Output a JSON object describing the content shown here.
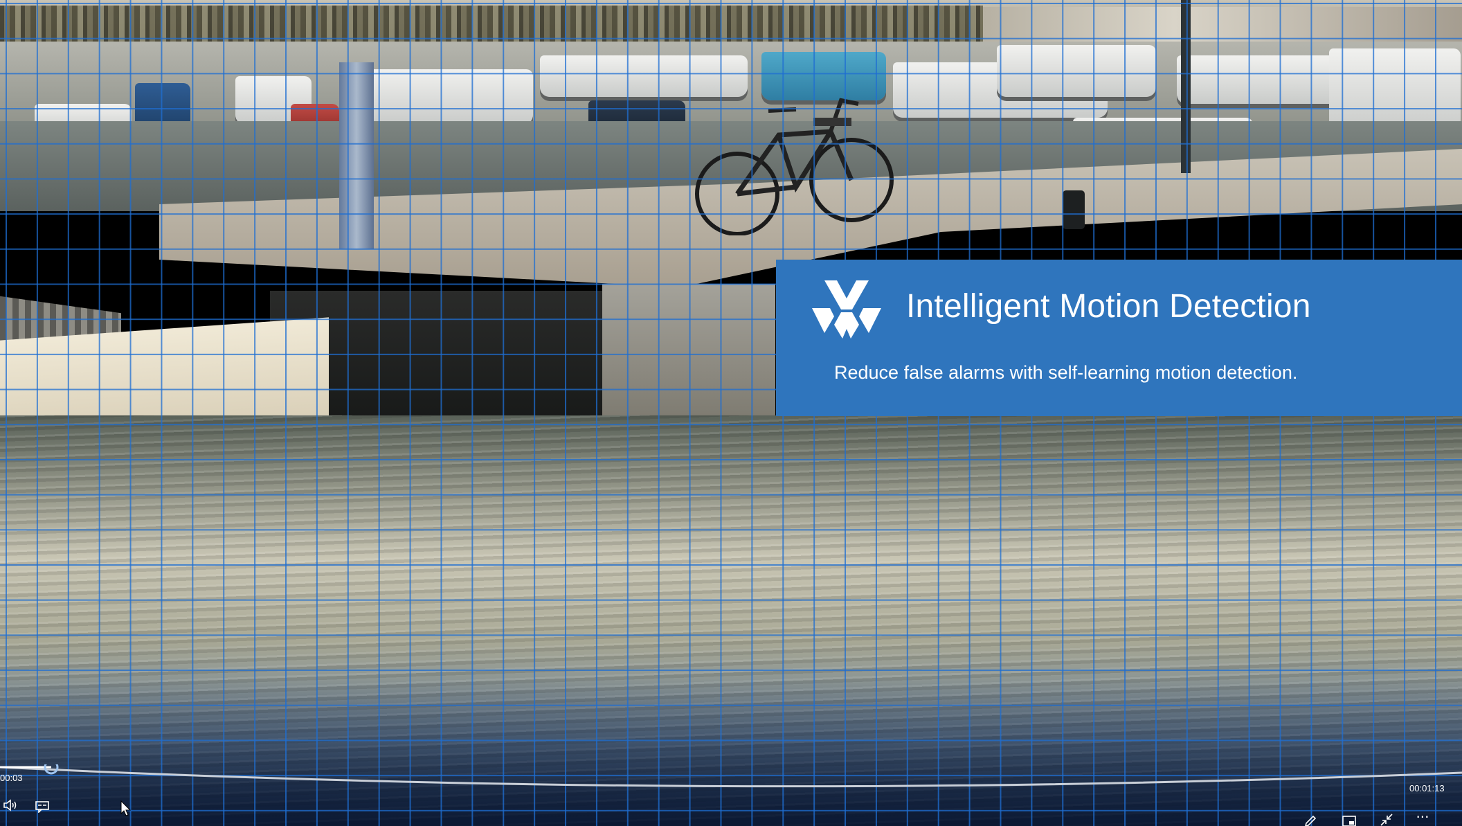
{
  "banner": {
    "title": "Intelligent Motion Detection",
    "subtitle": "Reduce false alarms with self-learning motion detection.",
    "background_color": "#2f75bd",
    "logo_icon": "brand-logo-icon"
  },
  "player": {
    "time_elapsed": "00:03",
    "time_remaining": "00:01:13",
    "progress_fraction": 0.035,
    "controls": {
      "volume_icon": "volume-icon",
      "captions_icon": "captions-icon",
      "edit_icon": "pencil-icon",
      "miniplayer_icon": "miniplayer-icon",
      "collapse_icon": "collapse-icon",
      "more_icon": "more-icon",
      "more_label": "···"
    }
  },
  "overlay": {
    "grid_color": "#1e6ed2"
  }
}
